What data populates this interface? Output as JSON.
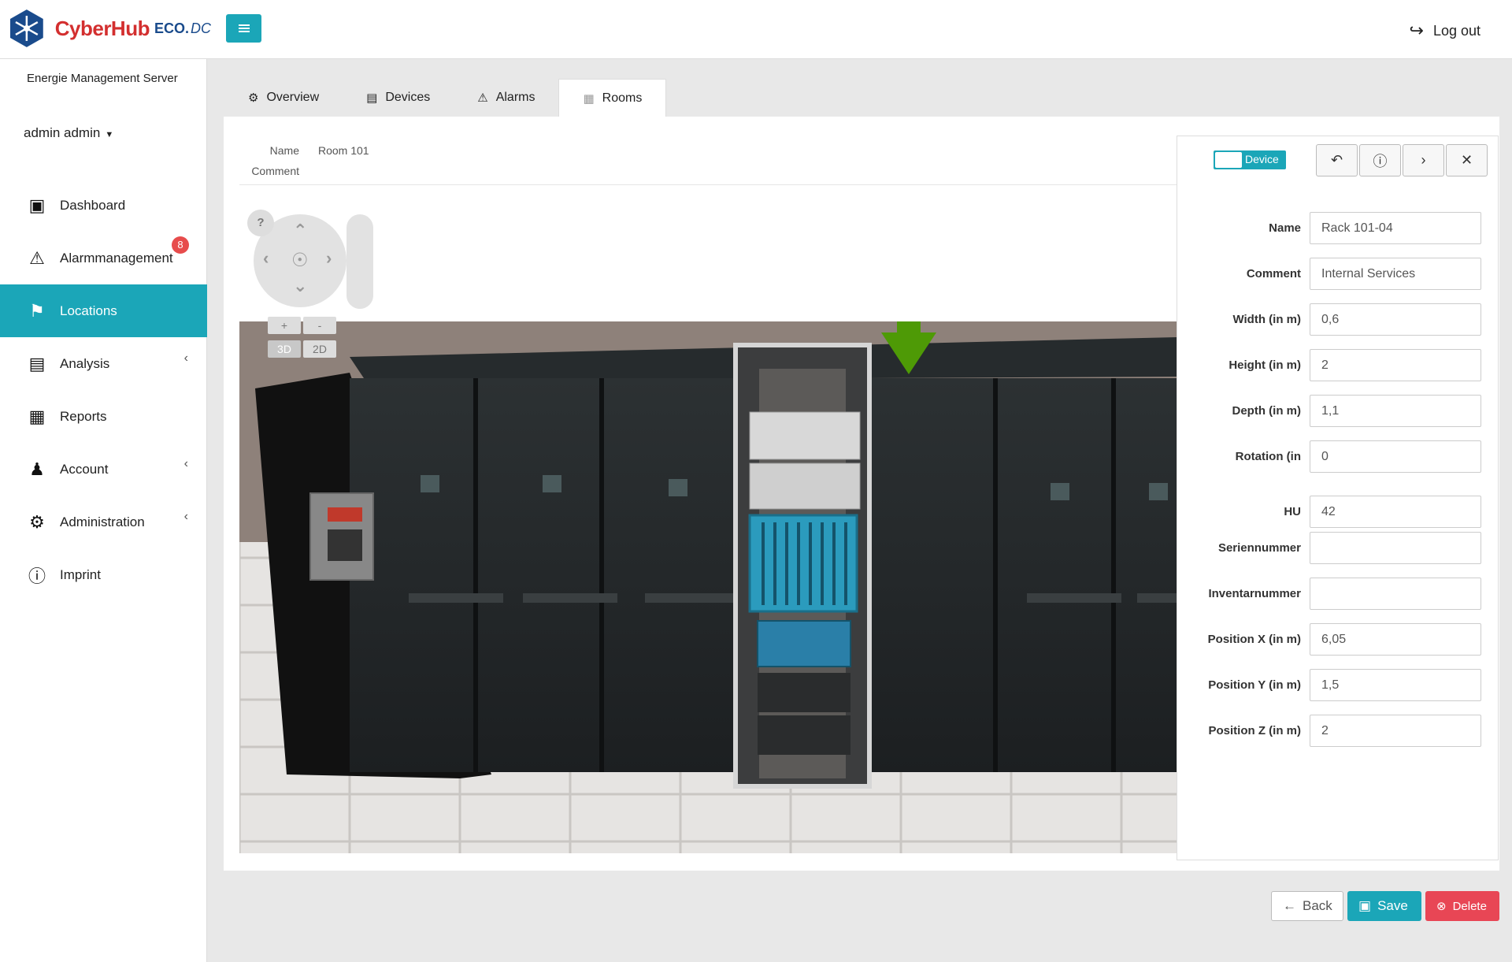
{
  "brand": {
    "name": "CyberHub",
    "eco": "ECO.",
    "dc": "DC"
  },
  "header": {
    "logout_label": "Log out"
  },
  "sidebar": {
    "server_name": "Energie Management Server",
    "user": "admin admin",
    "items": [
      {
        "label": "Dashboard"
      },
      {
        "label": "Alarmmanagement",
        "badge": "8"
      },
      {
        "label": "Locations"
      },
      {
        "label": "Analysis"
      },
      {
        "label": "Reports"
      },
      {
        "label": "Account"
      },
      {
        "label": "Administration"
      },
      {
        "label": "Imprint"
      }
    ]
  },
  "tabs": [
    {
      "label": "Overview"
    },
    {
      "label": "Devices"
    },
    {
      "label": "Alarms"
    },
    {
      "label": "Rooms"
    }
  ],
  "room": {
    "name_label": "Name",
    "name_value": "Room 101",
    "comment_label": "Comment"
  },
  "viewer": {
    "help": "?",
    "zoom_in": "+",
    "zoom_out": "-",
    "mode_3d": "3D",
    "mode_2d": "2D"
  },
  "detail": {
    "toggle_label": "Device",
    "fields": [
      {
        "label": "Name",
        "value": "Rack 101-04"
      },
      {
        "label": "Comment",
        "value": "Internal Services"
      },
      {
        "label": "Width (in m)",
        "value": "0,6"
      },
      {
        "label": "Height (in m)",
        "value": "2"
      },
      {
        "label": "Depth (in m)",
        "value": "1,1"
      },
      {
        "label": "Rotation (in",
        "value": "0"
      },
      {
        "label": "HU",
        "value": "42"
      },
      {
        "label": "Seriennummer",
        "value": ""
      },
      {
        "label": "Inventarnummer",
        "value": ""
      },
      {
        "label": "Position X (in m)",
        "value": "6,05"
      },
      {
        "label": "Position Y (in m)",
        "value": "1,5"
      },
      {
        "label": "Position Z (in m)",
        "value": "2"
      }
    ]
  },
  "actions": {
    "back": "Back",
    "save": "Save",
    "delete": "Delete"
  },
  "colors": {
    "accent": "#1ba6b8",
    "danger": "#e84655",
    "brand_red": "#d32f2f",
    "arrow": "#4e9a06"
  }
}
